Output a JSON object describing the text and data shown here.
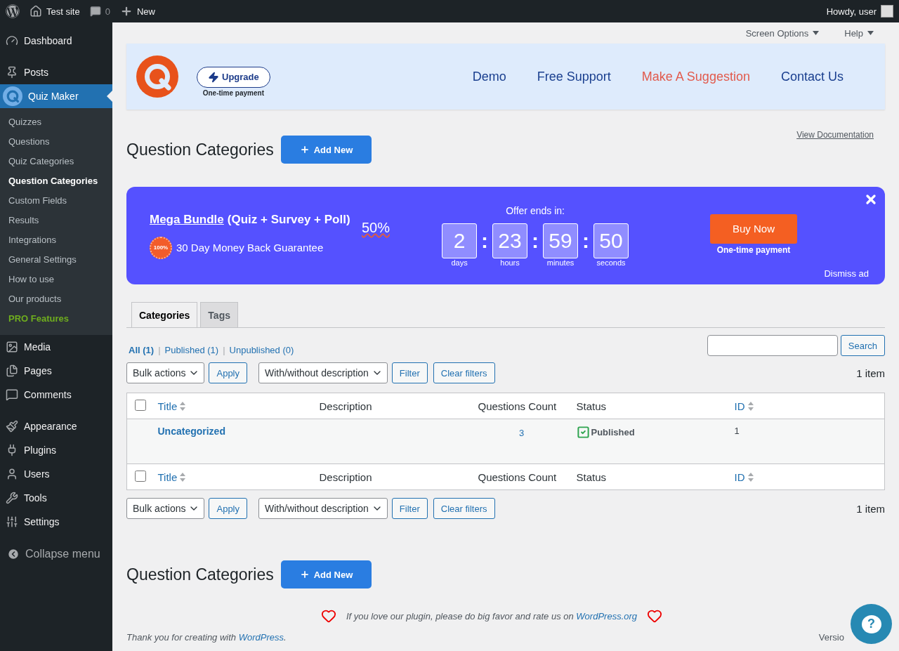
{
  "admin_bar": {
    "site": "Test site",
    "comments": "0",
    "new": "New",
    "greeting": "Howdy, user"
  },
  "sidebar": {
    "groups": [
      [
        {
          "label": "Dashboard",
          "selected": false
        }
      ],
      [
        {
          "label": "Posts",
          "selected": false
        },
        {
          "label": "Quiz Maker",
          "selected": true,
          "children": [
            {
              "label": "Quizzes",
              "selected": false,
              "kind": "link"
            },
            {
              "label": "Questions",
              "selected": false,
              "kind": "link"
            },
            {
              "label": "Quiz Categories",
              "selected": false,
              "kind": "link"
            },
            {
              "label": "Question Categories",
              "selected": true,
              "kind": "link"
            },
            {
              "label": "Custom Fields",
              "selected": false,
              "kind": "link"
            },
            {
              "label": "Results",
              "selected": false,
              "kind": "link"
            },
            {
              "label": "Integrations",
              "selected": false,
              "kind": "link"
            },
            {
              "label": "General Settings",
              "selected": false,
              "kind": "link"
            },
            {
              "label": "How to use",
              "selected": false,
              "kind": "link"
            },
            {
              "label": "Our products",
              "selected": false,
              "kind": "link"
            },
            {
              "label": "PRO Features",
              "selected": false,
              "kind": "pro"
            }
          ]
        },
        {
          "label": "Media",
          "selected": false
        },
        {
          "label": "Pages",
          "selected": false
        },
        {
          "label": "Comments",
          "selected": false
        }
      ],
      [
        {
          "label": "Appearance",
          "selected": false
        },
        {
          "label": "Plugins",
          "selected": false
        },
        {
          "label": "Users",
          "selected": false
        },
        {
          "label": "Tools",
          "selected": false
        },
        {
          "label": "Settings",
          "selected": false
        }
      ]
    ],
    "collapse": "Collapse menu"
  },
  "screen_meta": [
    "Screen Options",
    "Help"
  ],
  "plugin_header": {
    "upgrade": "Upgrade",
    "upgrade_note": "One-time payment",
    "links": [
      {
        "label": "Demo",
        "color": "#1a3f8f"
      },
      {
        "label": "Free Support",
        "color": "#1a3f8f"
      },
      {
        "label": "Make A Suggestion",
        "color": "#e25a4c"
      },
      {
        "label": "Contact Us",
        "color": "#1a3f8f"
      }
    ]
  },
  "heading": {
    "title": "Question Categories",
    "add_new": "Add New",
    "view_doc": "View Documentation"
  },
  "promo": {
    "title_link": "Mega Bundle",
    "title_rest": "(Quiz + Survey + Poll)",
    "discount": "50%",
    "badge": "100%",
    "guarantee": "30 Day Money Back Guarantee",
    "offer_label": "Offer ends in:",
    "separator": ":",
    "countdown": [
      {
        "value": "2",
        "unit": "days"
      },
      {
        "value": "23",
        "unit": "hours"
      },
      {
        "value": "59",
        "unit": "minutes"
      },
      {
        "value": "50",
        "unit": "seconds"
      }
    ],
    "buy": "Buy Now",
    "buy_note": "One-time payment",
    "dismiss": "Dismiss ad"
  },
  "tabs": [
    {
      "label": "Categories",
      "selected": true
    },
    {
      "label": "Tags",
      "selected": false
    }
  ],
  "views": [
    {
      "label": "All",
      "count": "(1)",
      "selected": true
    },
    {
      "label": "Published",
      "count": "(1)",
      "selected": false
    },
    {
      "label": "Unpublished",
      "count": "(0)",
      "selected": false
    }
  ],
  "view_separator": "|",
  "search": {
    "button": "Search"
  },
  "tablenav_top": {
    "bulk": "Bulk actions",
    "apply": "Apply",
    "filter_select": "With/without description",
    "filter": "Filter",
    "clear": "Clear filters",
    "count": "1 item"
  },
  "table": {
    "columns": [
      {
        "label": "Title",
        "sortable": true
      },
      {
        "label": "Description",
        "sortable": false
      },
      {
        "label": "Questions Count",
        "sortable": false
      },
      {
        "label": "Status",
        "sortable": false
      },
      {
        "label": "ID",
        "sortable": true
      }
    ],
    "header_checked": false,
    "rows": [
      {
        "title": "Uncategorized",
        "count": "3",
        "status": "Published",
        "id": "1"
      }
    ],
    "footer_columns": [
      {
        "label": "Title",
        "sortable": true
      },
      {
        "label": "Description",
        "sortable": false
      },
      {
        "label": "Questions Count",
        "sortable": false
      },
      {
        "label": "Status",
        "sortable": false
      },
      {
        "label": "ID",
        "sortable": true
      }
    ],
    "footer_checked": false
  },
  "tablenav_bottom": {
    "bulk": "Bulk actions",
    "apply": "Apply",
    "filter_select": "With/without description",
    "filter": "Filter",
    "clear": "Clear filters",
    "count": "1 item"
  },
  "heading_bottom": {
    "title": "Question Categories",
    "add_new": "Add New"
  },
  "footer": {
    "rate_text": "If you love our plugin, please do big favor and rate us on",
    "rate_link": "WordPress.org",
    "thanks_text": "Thank you for creating with",
    "thanks_link": "WordPress",
    "thanks_end": ".",
    "version": "Versio",
    "help": "?"
  }
}
